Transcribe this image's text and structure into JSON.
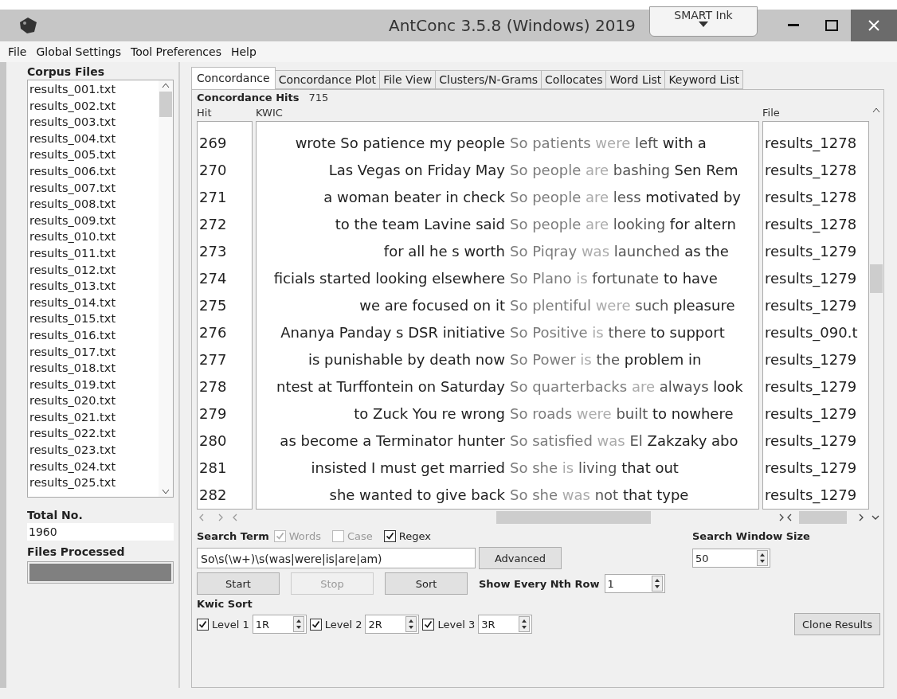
{
  "window": {
    "title": "AntConc 3.5.8 (Windows) 2019",
    "ink_button": "SMART Ink"
  },
  "menu": [
    "File",
    "Global Settings",
    "Tool Preferences",
    "Help"
  ],
  "corpus": {
    "title": "Corpus Files",
    "files": [
      "results_001.txt",
      "results_002.txt",
      "results_003.txt",
      "results_004.txt",
      "results_005.txt",
      "results_006.txt",
      "results_007.txt",
      "results_008.txt",
      "results_009.txt",
      "results_010.txt",
      "results_011.txt",
      "results_012.txt",
      "results_013.txt",
      "results_014.txt",
      "results_015.txt",
      "results_016.txt",
      "results_017.txt",
      "results_018.txt",
      "results_019.txt",
      "results_020.txt",
      "results_021.txt",
      "results_022.txt",
      "results_023.txt",
      "results_024.txt",
      "results_025.txt"
    ],
    "total_label": "Total No.",
    "total": "1960",
    "processed_label": "Files Processed",
    "progress": {
      "level": 1
    }
  },
  "tabs": [
    {
      "label": "Concordance",
      "selected": true
    },
    {
      "label": "Concordance Plot",
      "selected": false
    },
    {
      "label": "File View",
      "selected": false
    },
    {
      "label": "Clusters/N-Grams",
      "selected": false
    },
    {
      "label": "Collocates",
      "selected": false
    },
    {
      "label": "Word List",
      "selected": false
    },
    {
      "label": "Keyword List",
      "selected": false
    }
  ],
  "hits": {
    "label": "Concordance Hits",
    "count": "715"
  },
  "table": {
    "columns": [
      "Hit",
      "KWIC",
      "File"
    ],
    "rows": [
      {
        "hit": "269",
        "left": "wrote So patience my people",
        "right": [
          {
            "text": "So",
            "color": "#7c7c7c"
          },
          {
            "text": "patients",
            "color": "#7c7c7c"
          },
          {
            "text": "were",
            "color": "#ababab"
          },
          {
            "text": "left",
            "color": "#555555"
          },
          {
            "text": "with a",
            "color": "#222222"
          }
        ],
        "file": "results_1278"
      },
      {
        "hit": "270",
        "left": "Las Vegas on Friday May",
        "right": [
          {
            "text": "So",
            "color": "#7c7c7c"
          },
          {
            "text": "people",
            "color": "#7c7c7c"
          },
          {
            "text": "are",
            "color": "#ababab"
          },
          {
            "text": "bashing",
            "color": "#555555"
          },
          {
            "text": "Sen Rem",
            "color": "#222222"
          }
        ],
        "file": "results_1278"
      },
      {
        "hit": "271",
        "left": "a woman beater in check",
        "right": [
          {
            "text": "So",
            "color": "#7c7c7c"
          },
          {
            "text": "people",
            "color": "#7c7c7c"
          },
          {
            "text": "are",
            "color": "#ababab"
          },
          {
            "text": "less",
            "color": "#555555"
          },
          {
            "text": "motivated by",
            "color": "#222222"
          }
        ],
        "file": "results_1278"
      },
      {
        "hit": "272",
        "left": "to the team Lavine said",
        "right": [
          {
            "text": "So",
            "color": "#7c7c7c"
          },
          {
            "text": "people",
            "color": "#7c7c7c"
          },
          {
            "text": "are",
            "color": "#ababab"
          },
          {
            "text": "looking",
            "color": "#555555"
          },
          {
            "text": "for altern",
            "color": "#222222"
          }
        ],
        "file": "results_1278"
      },
      {
        "hit": "273",
        "left": "for all he s worth",
        "right": [
          {
            "text": "So",
            "color": "#7c7c7c"
          },
          {
            "text": "Piqray",
            "color": "#7c7c7c"
          },
          {
            "text": "was",
            "color": "#ababab"
          },
          {
            "text": "launched",
            "color": "#555555"
          },
          {
            "text": "as the",
            "color": "#222222"
          }
        ],
        "file": "results_1279"
      },
      {
        "hit": "274",
        "left": "ficials started looking elsewhere",
        "right": [
          {
            "text": "So",
            "color": "#7c7c7c"
          },
          {
            "text": "Plano",
            "color": "#7c7c7c"
          },
          {
            "text": "is",
            "color": "#ababab"
          },
          {
            "text": "fortunate",
            "color": "#555555"
          },
          {
            "text": "to have",
            "color": "#222222"
          }
        ],
        "file": "results_1279"
      },
      {
        "hit": "275",
        "left": "we are focused on it",
        "right": [
          {
            "text": "So",
            "color": "#7c7c7c"
          },
          {
            "text": "plentiful",
            "color": "#7c7c7c"
          },
          {
            "text": "were",
            "color": "#ababab"
          },
          {
            "text": "such",
            "color": "#555555"
          },
          {
            "text": "pleasure",
            "color": "#222222"
          }
        ],
        "file": "results_1279"
      },
      {
        "hit": "276",
        "left": "Ananya Panday s DSR initiative",
        "right": [
          {
            "text": "So",
            "color": "#7c7c7c"
          },
          {
            "text": "Positive",
            "color": "#7c7c7c"
          },
          {
            "text": "is",
            "color": "#ababab"
          },
          {
            "text": "there",
            "color": "#555555"
          },
          {
            "text": "to support",
            "color": "#222222"
          }
        ],
        "file": "results_090.t"
      },
      {
        "hit": "277",
        "left": "is punishable by death now",
        "right": [
          {
            "text": "So",
            "color": "#7c7c7c"
          },
          {
            "text": "Power",
            "color": "#7c7c7c"
          },
          {
            "text": "is",
            "color": "#ababab"
          },
          {
            "text": "the",
            "color": "#555555"
          },
          {
            "text": "problem in",
            "color": "#222222"
          }
        ],
        "file": "results_1279"
      },
      {
        "hit": "278",
        "left": "ntest at Turffontein on Saturday",
        "right": [
          {
            "text": "So",
            "color": "#7c7c7c"
          },
          {
            "text": "quarterbacks",
            "color": "#7c7c7c"
          },
          {
            "text": "are",
            "color": "#ababab"
          },
          {
            "text": "always",
            "color": "#555555"
          },
          {
            "text": "look",
            "color": "#222222"
          }
        ],
        "file": "results_1279"
      },
      {
        "hit": "279",
        "left": "to Zuck You re wrong",
        "right": [
          {
            "text": "So",
            "color": "#7c7c7c"
          },
          {
            "text": "roads",
            "color": "#7c7c7c"
          },
          {
            "text": "were",
            "color": "#ababab"
          },
          {
            "text": "built",
            "color": "#555555"
          },
          {
            "text": "to nowhere",
            "color": "#222222"
          }
        ],
        "file": "results_1279"
      },
      {
        "hit": "280",
        "left": "as become a Terminator hunter",
        "right": [
          {
            "text": "So",
            "color": "#7c7c7c"
          },
          {
            "text": "satisfied",
            "color": "#7c7c7c"
          },
          {
            "text": "was",
            "color": "#ababab"
          },
          {
            "text": "El",
            "color": "#555555"
          },
          {
            "text": "Zakzaky abo",
            "color": "#222222"
          }
        ],
        "file": "results_1279"
      },
      {
        "hit": "281",
        "left": "insisted I must get married",
        "right": [
          {
            "text": "So",
            "color": "#7c7c7c"
          },
          {
            "text": "she",
            "color": "#7c7c7c"
          },
          {
            "text": "is",
            "color": "#ababab"
          },
          {
            "text": "living",
            "color": "#555555"
          },
          {
            "text": "that out",
            "color": "#222222"
          }
        ],
        "file": "results_1279"
      },
      {
        "hit": "282",
        "left": "she wanted to give back",
        "right": [
          {
            "text": "So",
            "color": "#7c7c7c"
          },
          {
            "text": "she",
            "color": "#7c7c7c"
          },
          {
            "text": "was",
            "color": "#ababab"
          },
          {
            "text": "not",
            "color": "#555555"
          },
          {
            "text": "that type",
            "color": "#222222"
          }
        ],
        "file": "results_1279"
      }
    ]
  },
  "search": {
    "label": "Search Term",
    "options": [
      {
        "label": "Words",
        "checked": true,
        "disabled": true
      },
      {
        "label": "Case",
        "checked": false,
        "disabled": true
      },
      {
        "label": "Regex",
        "checked": true,
        "disabled": false
      }
    ],
    "term": "So\\s(\\w+)\\s(was|were|is|are|am)",
    "advanced": "Advanced",
    "window_label": "Search Window Size",
    "window_size": "50"
  },
  "actions": [
    {
      "label": "Start",
      "disabled": false
    },
    {
      "label": "Stop",
      "disabled": true
    },
    {
      "label": "Sort",
      "disabled": false
    }
  ],
  "nth": {
    "label": "Show Every Nth Row",
    "value": "1"
  },
  "kwic_sort": {
    "label": "Kwic Sort",
    "levels": [
      {
        "label": "Level 1",
        "checked": true,
        "value": "1R"
      },
      {
        "label": "Level 2",
        "checked": true,
        "value": "2R"
      },
      {
        "label": "Level 3",
        "checked": true,
        "value": "3R"
      }
    ]
  },
  "clone": "Clone Results"
}
